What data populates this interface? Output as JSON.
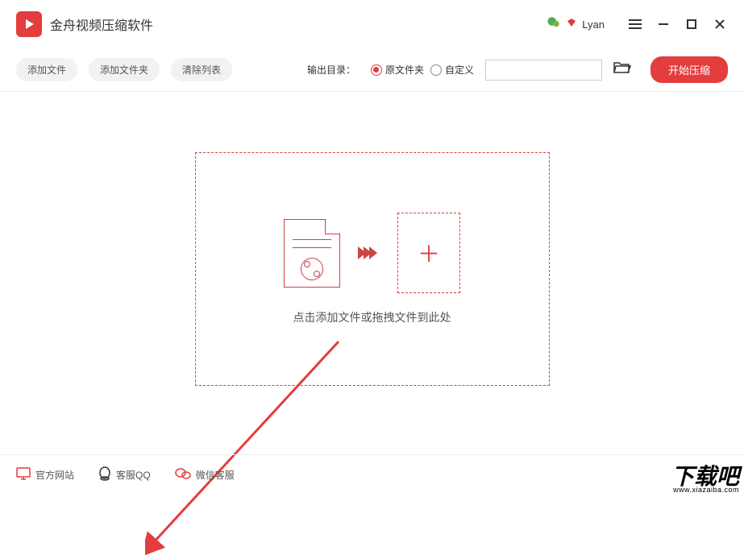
{
  "titlebar": {
    "app_title": "金舟视频压缩软件",
    "username": "Lyan"
  },
  "toolbar": {
    "add_file": "添加文件",
    "add_folder": "添加文件夹",
    "clear_list": "清除列表",
    "output_label": "输出目录：",
    "radio_original": "原文件夹",
    "radio_custom": "自定义",
    "path_value": "",
    "start_btn": "开始压缩"
  },
  "dropzone": {
    "text": "点击添加文件或拖拽文件到此处"
  },
  "footer": {
    "official_site": "官方网站",
    "customer_qq": "客服QQ",
    "wechat_service": "微信客服"
  },
  "watermark": {
    "main": "下载吧",
    "url": "www.xiazaiba.com"
  }
}
